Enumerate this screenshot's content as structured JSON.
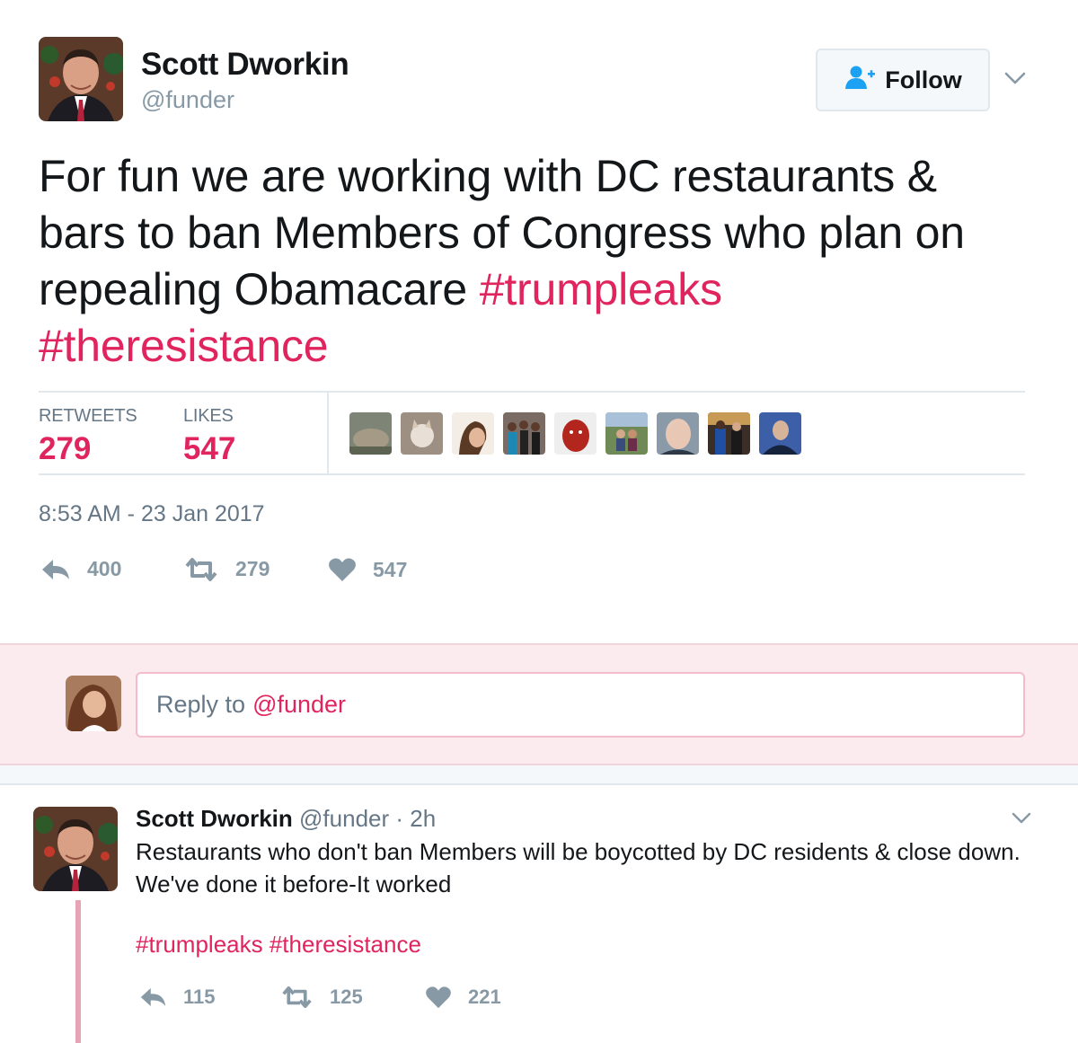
{
  "tweet": {
    "author_name": "Scott Dworkin",
    "author_handle": "@funder",
    "follow_label": "Follow",
    "text": "For fun we are working with DC restaurants & bars to ban Members of Congress who plan on repealing Obamacare ",
    "hashtags": [
      "#trumpleaks",
      "#theresistance"
    ],
    "stats": {
      "retweets_label": "RETWEETS",
      "retweets_value": "279",
      "likes_label": "LIKES",
      "likes_value": "547"
    },
    "timestamp": "8:53 AM - 23 Jan 2017",
    "actions": {
      "reply_count": "400",
      "retweet_count": "279",
      "like_count": "547"
    }
  },
  "reply_composer": {
    "placeholder_prefix": "Reply to",
    "placeholder_handle": "@funder"
  },
  "reply_tweet": {
    "author_name": "Scott Dworkin",
    "author_handle": "@funder",
    "time": "· 2h",
    "text": "Restaurants who don't ban Members will be boycotted by DC residents & close down. We've done it before-It worked",
    "hashtags": "#trumpleaks #theresistance",
    "actions": {
      "reply_count": "115",
      "retweet_count": "125",
      "like_count": "221"
    }
  },
  "colors": {
    "accent": "#e0245e",
    "muted": "#8899a6",
    "reply_band": "#fbeaee"
  },
  "icons": [
    "person-add-icon",
    "chevron-down-icon",
    "reply-icon",
    "retweet-icon",
    "heart-icon"
  ]
}
